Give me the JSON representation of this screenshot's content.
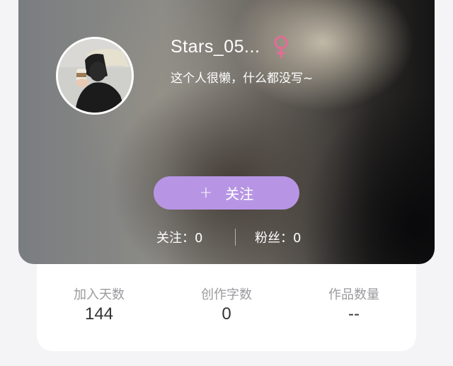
{
  "profile": {
    "username": "Stars_05...",
    "gender": "female",
    "gender_icon": "female-icon",
    "gender_color": "#e56b94",
    "bio": "这个人很懒，什么都没写~"
  },
  "follow_button": {
    "icon": "+",
    "label": "关注",
    "color": "#b795e4"
  },
  "counts": {
    "following_label": "关注：",
    "following_value": "0",
    "fans_label": "粉丝：",
    "fans_value": "0"
  },
  "stats": [
    {
      "label": "加入天数",
      "value": "144"
    },
    {
      "label": "创作字数",
      "value": "0"
    },
    {
      "label": "作品数量",
      "value": "--"
    }
  ]
}
